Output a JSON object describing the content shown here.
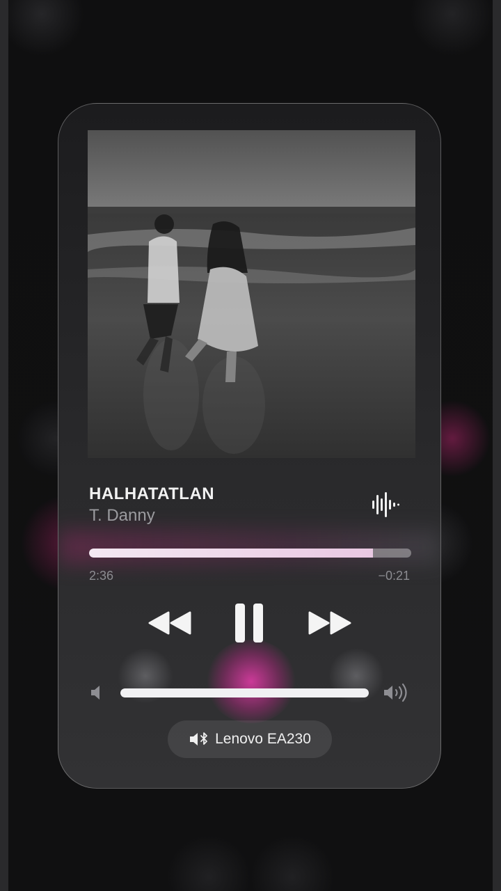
{
  "track": {
    "title": "HALHATATLAN",
    "artist": "T. Danny"
  },
  "playback": {
    "elapsed": "2:36",
    "remaining": "−0:21",
    "progress_fraction": 0.881,
    "state": "playing"
  },
  "volume": {
    "level_fraction": 1.0
  },
  "output_device": {
    "name": "Lenovo EA230",
    "icon": "speaker-bluetooth-icon"
  },
  "icons": {
    "waveform": "waveform-icon",
    "rewind": "rewind-icon",
    "pause": "pause-icon",
    "forward": "fast-forward-icon",
    "volume_low": "volume-low-icon",
    "volume_high": "volume-high-icon"
  },
  "colors": {
    "card_background": "#2a2a2c",
    "progress_fill": "#f4e8f2",
    "accent_glow": "#e03ca8",
    "text_primary": "#f2f2f2",
    "text_secondary": "#9b9b9f"
  }
}
